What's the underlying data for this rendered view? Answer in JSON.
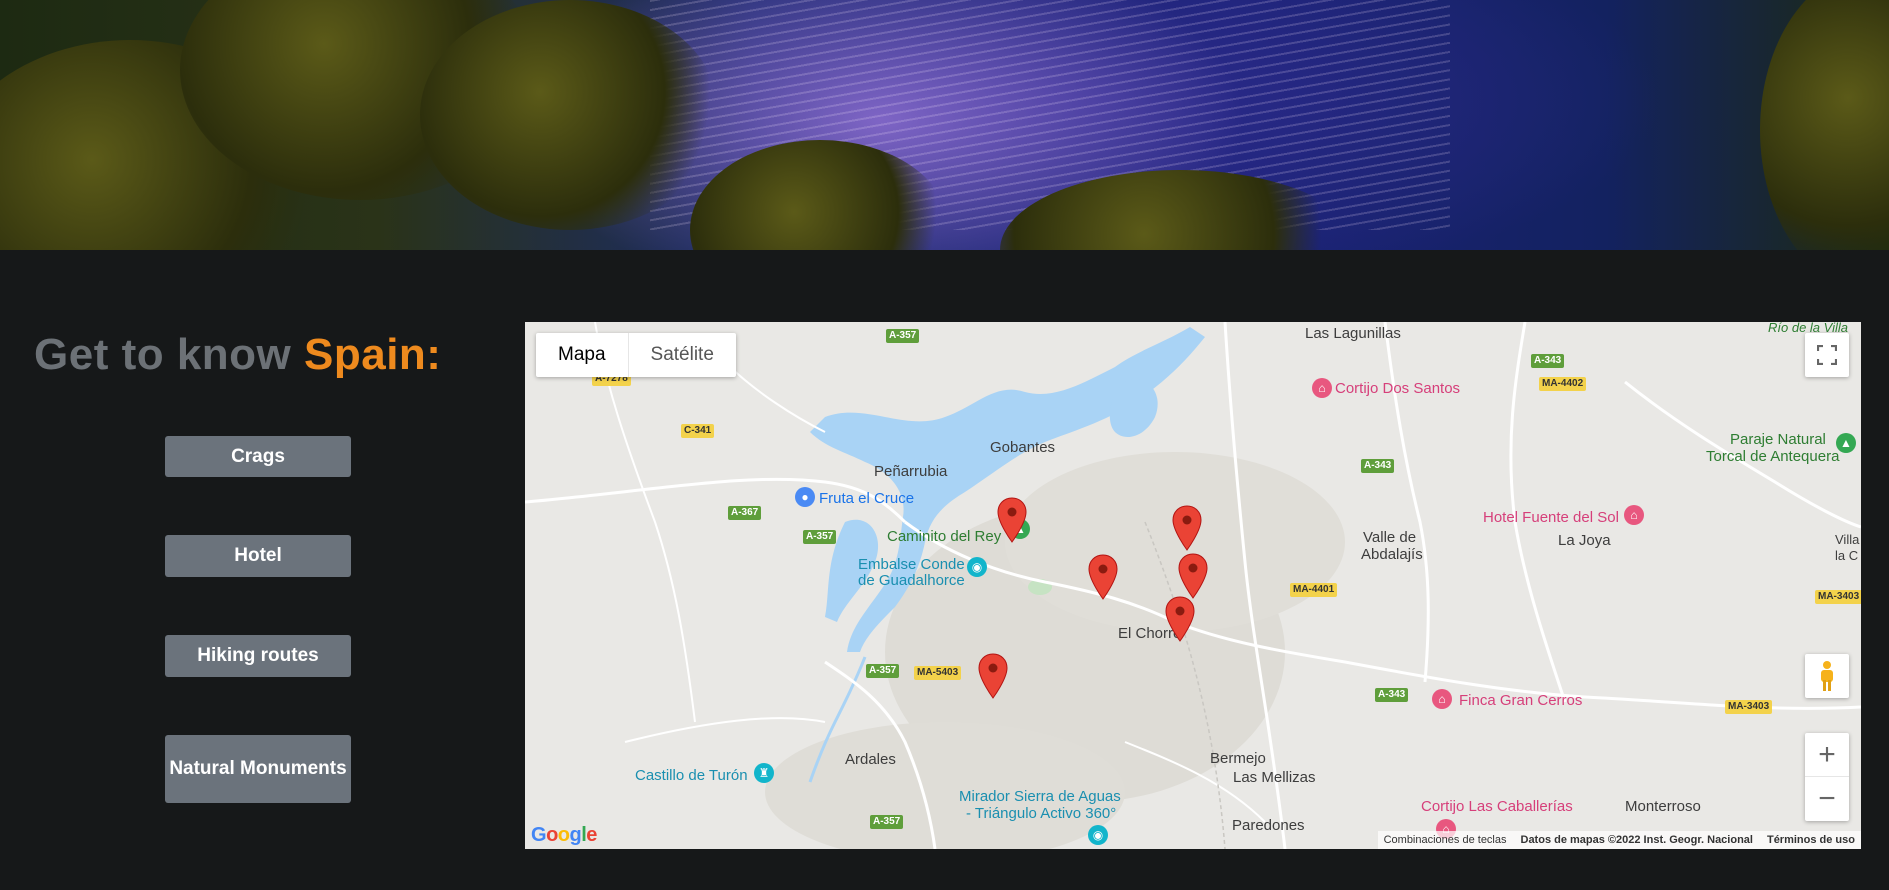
{
  "hero": {
    "image": "lake-with-pine-trees-photo"
  },
  "section": {
    "title_prefix": "Get to know ",
    "title_accent": "Spain:",
    "buttons": [
      {
        "label": "Crags"
      },
      {
        "label": "Hotel"
      },
      {
        "label": "Hiking routes"
      },
      {
        "label": "Natural Monuments"
      }
    ]
  },
  "map": {
    "type_controls": {
      "map": "Mapa",
      "satellite": "Satélite"
    },
    "fullscreen_icon": "fullscreen-icon",
    "pegman_icon": "pegman-icon",
    "zoom_in": "+",
    "zoom_out": "−",
    "towns": {
      "las_lagunillas": "Las Lagunillas",
      "gobantes": "Gobantes",
      "penarrubia": "Peñarrubia",
      "valle_1": "Valle de",
      "valle_2": "Abdalajís",
      "la_joya": "La Joya",
      "el_chorro": "El Chorro",
      "ardales": "Ardales",
      "bermejo": "Bermejo",
      "las_mellizas": "Las Mellizas",
      "paredones": "Paredones",
      "monterroso": "Monterroso",
      "rio_villa": "Río de la Villa",
      "villa_1": "Villa",
      "villa_2": "la C"
    },
    "pois": {
      "cortijo_dos_santos": "Cortijo Dos Santos",
      "paraje_1": "Paraje Natural",
      "paraje_2": "Torcal de Antequera",
      "fruta_cruce": "Fruta el Cruce",
      "caminito": "Caminito del Rey",
      "embalse_1": "Embalse Conde",
      "embalse_2": "de Guadalhorce",
      "hotel_fuente": "Hotel Fuente del Sol",
      "finca": "Finca Gran Cerros",
      "castillo": "Castillo de Turón",
      "mirador_1": "Mirador Sierra de Aguas",
      "mirador_2": "- Triángulo Activo 360°",
      "cortijo_caballerias": "Cortijo Las Caballerías"
    },
    "roads": {
      "a357_1": "A-357",
      "a7278": "A-7278",
      "c341": "C-341",
      "a367": "A-367",
      "a357_2": "A-357",
      "a357_3": "A-357",
      "ma5403": "MA-5403",
      "a357_4": "A-357",
      "a343_1": "A-343",
      "ma4402": "MA-4402",
      "a343_2": "A-343",
      "ma4401": "MA-4401",
      "a343_3": "A-343",
      "ma3403_1": "MA-3403",
      "ma3403_2": "MA-3403"
    },
    "markers": [
      {
        "name": "marker-1"
      },
      {
        "name": "marker-2"
      },
      {
        "name": "marker-3"
      },
      {
        "name": "marker-4"
      },
      {
        "name": "marker-5"
      },
      {
        "name": "marker-6"
      }
    ],
    "logo": "Google",
    "attribution": {
      "shortcuts": "Combinaciones de teclas",
      "data": "Datos de mapas ©2022 Inst. Geogr. Nacional",
      "terms": "Términos de uso"
    }
  },
  "colors": {
    "accent": "#ee8a1e",
    "muted_title": "#6c7176",
    "button_bg": "#6b737c",
    "page_bg": "#161819",
    "marker": "#ea4335",
    "water": "#a9d3f5"
  }
}
